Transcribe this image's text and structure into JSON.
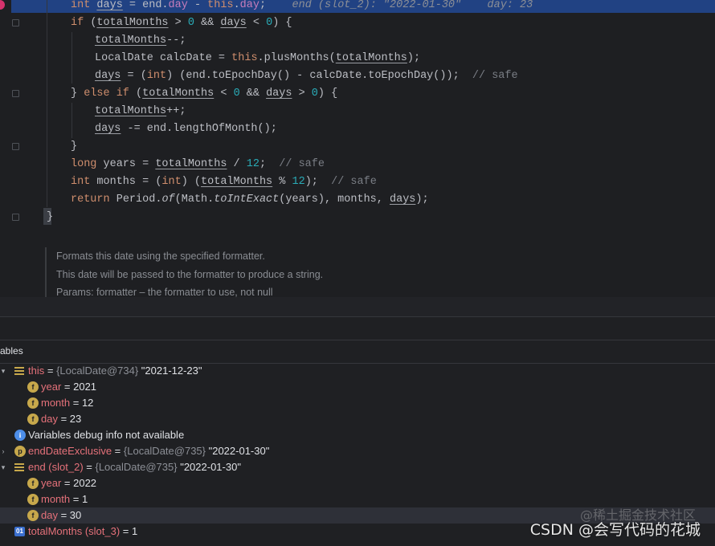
{
  "editor": {
    "lines": [
      {
        "segments": [
          {
            "t": "int ",
            "c": "kw"
          },
          {
            "t": "days",
            "c": "ul"
          },
          {
            "t": " = end."
          },
          {
            "t": "day",
            "c": "field"
          },
          {
            "t": " - "
          },
          {
            "t": "this",
            "c": "kw"
          },
          {
            "t": "."
          },
          {
            "t": "day",
            "c": "field"
          },
          {
            "t": ";  "
          },
          {
            "t": "  end (slot_2): \"2022-01-30\"    day: 23",
            "c": "inline-hint"
          }
        ]
      },
      {
        "segments": [
          {
            "t": "if ",
            "c": "kw"
          },
          {
            "t": "("
          },
          {
            "t": "totalMonths",
            "c": "ul"
          },
          {
            "t": " > "
          },
          {
            "t": "0",
            "c": "num"
          },
          {
            "t": " && "
          },
          {
            "t": "days",
            "c": "ul"
          },
          {
            "t": " < "
          },
          {
            "t": "0",
            "c": "num"
          },
          {
            "t": ") {"
          }
        ]
      },
      {
        "segments": [
          {
            "t": "totalMonths",
            "c": "ul"
          },
          {
            "t": "--;"
          }
        ]
      },
      {
        "segments": [
          {
            "t": "LocalDate calcDate = "
          },
          {
            "t": "this",
            "c": "kw"
          },
          {
            "t": ".plusMonths("
          },
          {
            "t": "totalMonths",
            "c": "ul"
          },
          {
            "t": ");"
          }
        ]
      },
      {
        "segments": [
          {
            "t": "days",
            "c": "ul"
          },
          {
            "t": " = ("
          },
          {
            "t": "int",
            "c": "kw"
          },
          {
            "t": ") (end.toEpochDay() - calcDate.toEpochDay());  "
          },
          {
            "t": "// safe",
            "c": "cmt"
          }
        ]
      },
      {
        "segments": [
          {
            "t": "} "
          },
          {
            "t": "else if ",
            "c": "kw"
          },
          {
            "t": "("
          },
          {
            "t": "totalMonths",
            "c": "ul"
          },
          {
            "t": " < "
          },
          {
            "t": "0",
            "c": "num"
          },
          {
            "t": " && "
          },
          {
            "t": "days",
            "c": "ul"
          },
          {
            "t": " > "
          },
          {
            "t": "0",
            "c": "num"
          },
          {
            "t": ") {"
          }
        ]
      },
      {
        "segments": [
          {
            "t": "totalMonths",
            "c": "ul"
          },
          {
            "t": "++;"
          }
        ]
      },
      {
        "segments": [
          {
            "t": "days",
            "c": "ul"
          },
          {
            "t": " -= end.lengthOfMonth();"
          }
        ]
      },
      {
        "segments": [
          {
            "t": "}"
          }
        ]
      },
      {
        "segments": [
          {
            "t": "long ",
            "c": "kw"
          },
          {
            "t": "years = "
          },
          {
            "t": "totalMonths",
            "c": "ul"
          },
          {
            "t": " / "
          },
          {
            "t": "12",
            "c": "num"
          },
          {
            "t": ";  "
          },
          {
            "t": "// safe",
            "c": "cmt"
          }
        ]
      },
      {
        "segments": [
          {
            "t": "int ",
            "c": "kw"
          },
          {
            "t": "months = ("
          },
          {
            "t": "int",
            "c": "kw"
          },
          {
            "t": ") ("
          },
          {
            "t": "totalMonths",
            "c": "ul"
          },
          {
            "t": " % "
          },
          {
            "t": "12",
            "c": "num"
          },
          {
            "t": ");  "
          },
          {
            "t": "// safe",
            "c": "cmt"
          }
        ]
      },
      {
        "segments": [
          {
            "t": "return ",
            "c": "kw"
          },
          {
            "t": "Period."
          },
          {
            "t": "of",
            "c": "it"
          },
          {
            "t": "(Math."
          },
          {
            "t": "toIntExact",
            "c": "it"
          },
          {
            "t": "(years), months, "
          },
          {
            "t": "days",
            "c": "ul"
          },
          {
            "t": ");"
          }
        ]
      },
      {
        "segments": [
          {
            "t": "}"
          }
        ]
      }
    ],
    "doc": [
      "Formats this date using the specified formatter.",
      "This date will be passed to the formatter to produce a string.",
      "Params:  formatter – the formatter to use, not null"
    ]
  },
  "debugger": {
    "title": "ables",
    "rows": [
      {
        "tri": "▾",
        "icon": "lines",
        "name": "this",
        "rest": " = ",
        "type": "{LocalDate@734}",
        "value": " \"2021-12-23\"",
        "indent": 0
      },
      {
        "tri": "",
        "icon": "f",
        "name": "year",
        "rest": " = 2021",
        "type": "",
        "value": "",
        "indent": 1
      },
      {
        "tri": "",
        "icon": "f",
        "name": "month",
        "rest": " = 12",
        "type": "",
        "value": "",
        "indent": 1
      },
      {
        "tri": "",
        "icon": "f",
        "name": "day",
        "rest": " = 23",
        "type": "",
        "value": "",
        "indent": 1
      },
      {
        "tri": "",
        "icon": "info",
        "name": "Variables debug info not available",
        "rest": "",
        "type": "",
        "value": "",
        "indent": 0,
        "plain": true
      },
      {
        "tri": "›",
        "icon": "p",
        "name": "endDateExclusive",
        "rest": " = ",
        "type": "{LocalDate@735}",
        "value": " \"2022-01-30\"",
        "indent": 0
      },
      {
        "tri": "▾",
        "icon": "lines",
        "name": "end (slot_2)",
        "rest": " = ",
        "type": "{LocalDate@735}",
        "value": " \"2022-01-30\"",
        "indent": 0
      },
      {
        "tri": "",
        "icon": "f",
        "name": "year",
        "rest": " = 2022",
        "type": "",
        "value": "",
        "indent": 1
      },
      {
        "tri": "",
        "icon": "f",
        "name": "month",
        "rest": " = 1",
        "type": "",
        "value": "",
        "indent": 1
      },
      {
        "tri": "",
        "icon": "f",
        "name": "day",
        "rest": " = 30",
        "type": "",
        "value": "",
        "indent": 1,
        "selected": true
      },
      {
        "tri": "",
        "icon": "prim",
        "name": "totalMonths (slot_3)",
        "rest": " = 1",
        "type": "",
        "value": "",
        "indent": 0
      }
    ],
    "icon_letters": {
      "f": "f",
      "p": "p",
      "info": "i",
      "prim": "01"
    }
  },
  "watermark": {
    "main": "CSDN @会写代码的花城",
    "faint": "@稀土掘金技术社区"
  },
  "colors": {
    "keyword": "#cf8e6d",
    "number": "#2aacb8",
    "field": "#c77dbb",
    "comment": "#7a7e85",
    "var_name": "#e5717a",
    "highlight": "#214283"
  }
}
